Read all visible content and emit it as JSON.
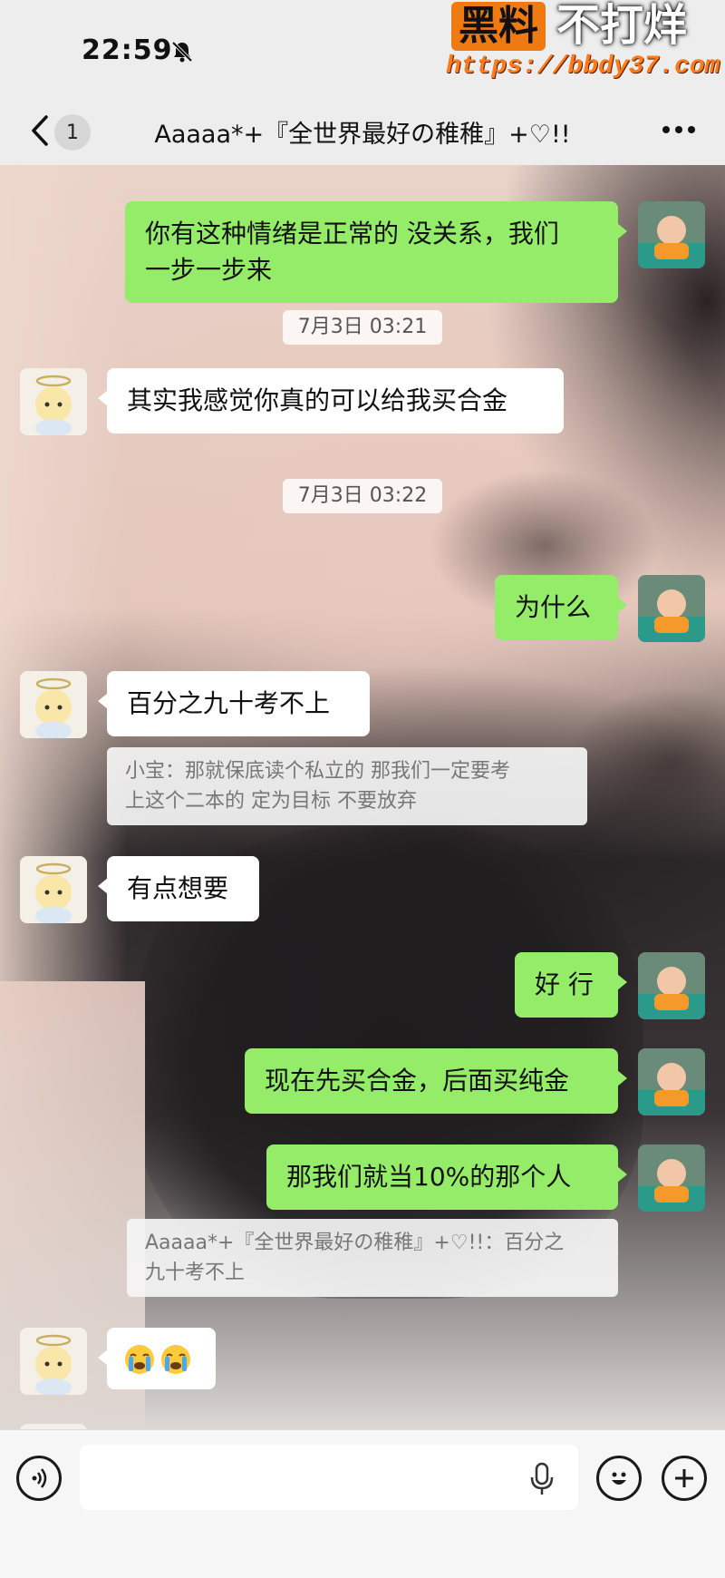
{
  "status_bar": {
    "time": "22:59",
    "icons": [
      "bell-slash-icon"
    ]
  },
  "watermark": {
    "badge": "黑料",
    "slogan": "不打烊",
    "url": "https://bbdy37.com"
  },
  "header": {
    "back_icon": "chevron-left-icon",
    "unread_count": "1",
    "title": "Aaaaa*+『全世界最好の稚稚』+♡!!",
    "more_icon": "more-dots-icon"
  },
  "messages": [
    {
      "side": "right",
      "text_lines": [
        "你有这种情绪是正常的 没关系，我们",
        "一步一步来"
      ]
    },
    {
      "timestamp": "7月3日 03:21"
    },
    {
      "side": "left",
      "text": "其实我感觉你真的可以给我买合金"
    },
    {
      "timestamp": "7月3日 03:22"
    },
    {
      "side": "right",
      "text": "为什么"
    },
    {
      "side": "left",
      "text": "百分之九十考不上",
      "quote_lines": [
        "小宝：那就保底读个私立的 那我们一定要考",
        "上这个二本的 定为目标 不要放弃"
      ]
    },
    {
      "side": "left",
      "text": "有点想要"
    },
    {
      "side": "right",
      "text": "好 行"
    },
    {
      "side": "right",
      "text": "现在先买合金，后面买纯金"
    },
    {
      "side": "right",
      "text": "那我们就当10%的那个人",
      "quote_lines": [
        "Aaaaa*+『全世界最好の稚稚』+♡!!：百分之",
        "九十考不上"
      ]
    },
    {
      "side": "left",
      "emoji": [
        "loudly-crying-face",
        "loudly-crying-face"
      ]
    }
  ],
  "input_bar": {
    "voice_icon": "voice-mode-icon",
    "mic_icon": "microphone-icon",
    "emoji_icon": "smiley-icon",
    "add_icon": "plus-circle-icon",
    "placeholder": ""
  },
  "colors": {
    "my_bubble": "#95ec69",
    "their_bubble": "#ffffff",
    "bar_bg": "#ededed",
    "watermark_orange": "#f07a12"
  }
}
